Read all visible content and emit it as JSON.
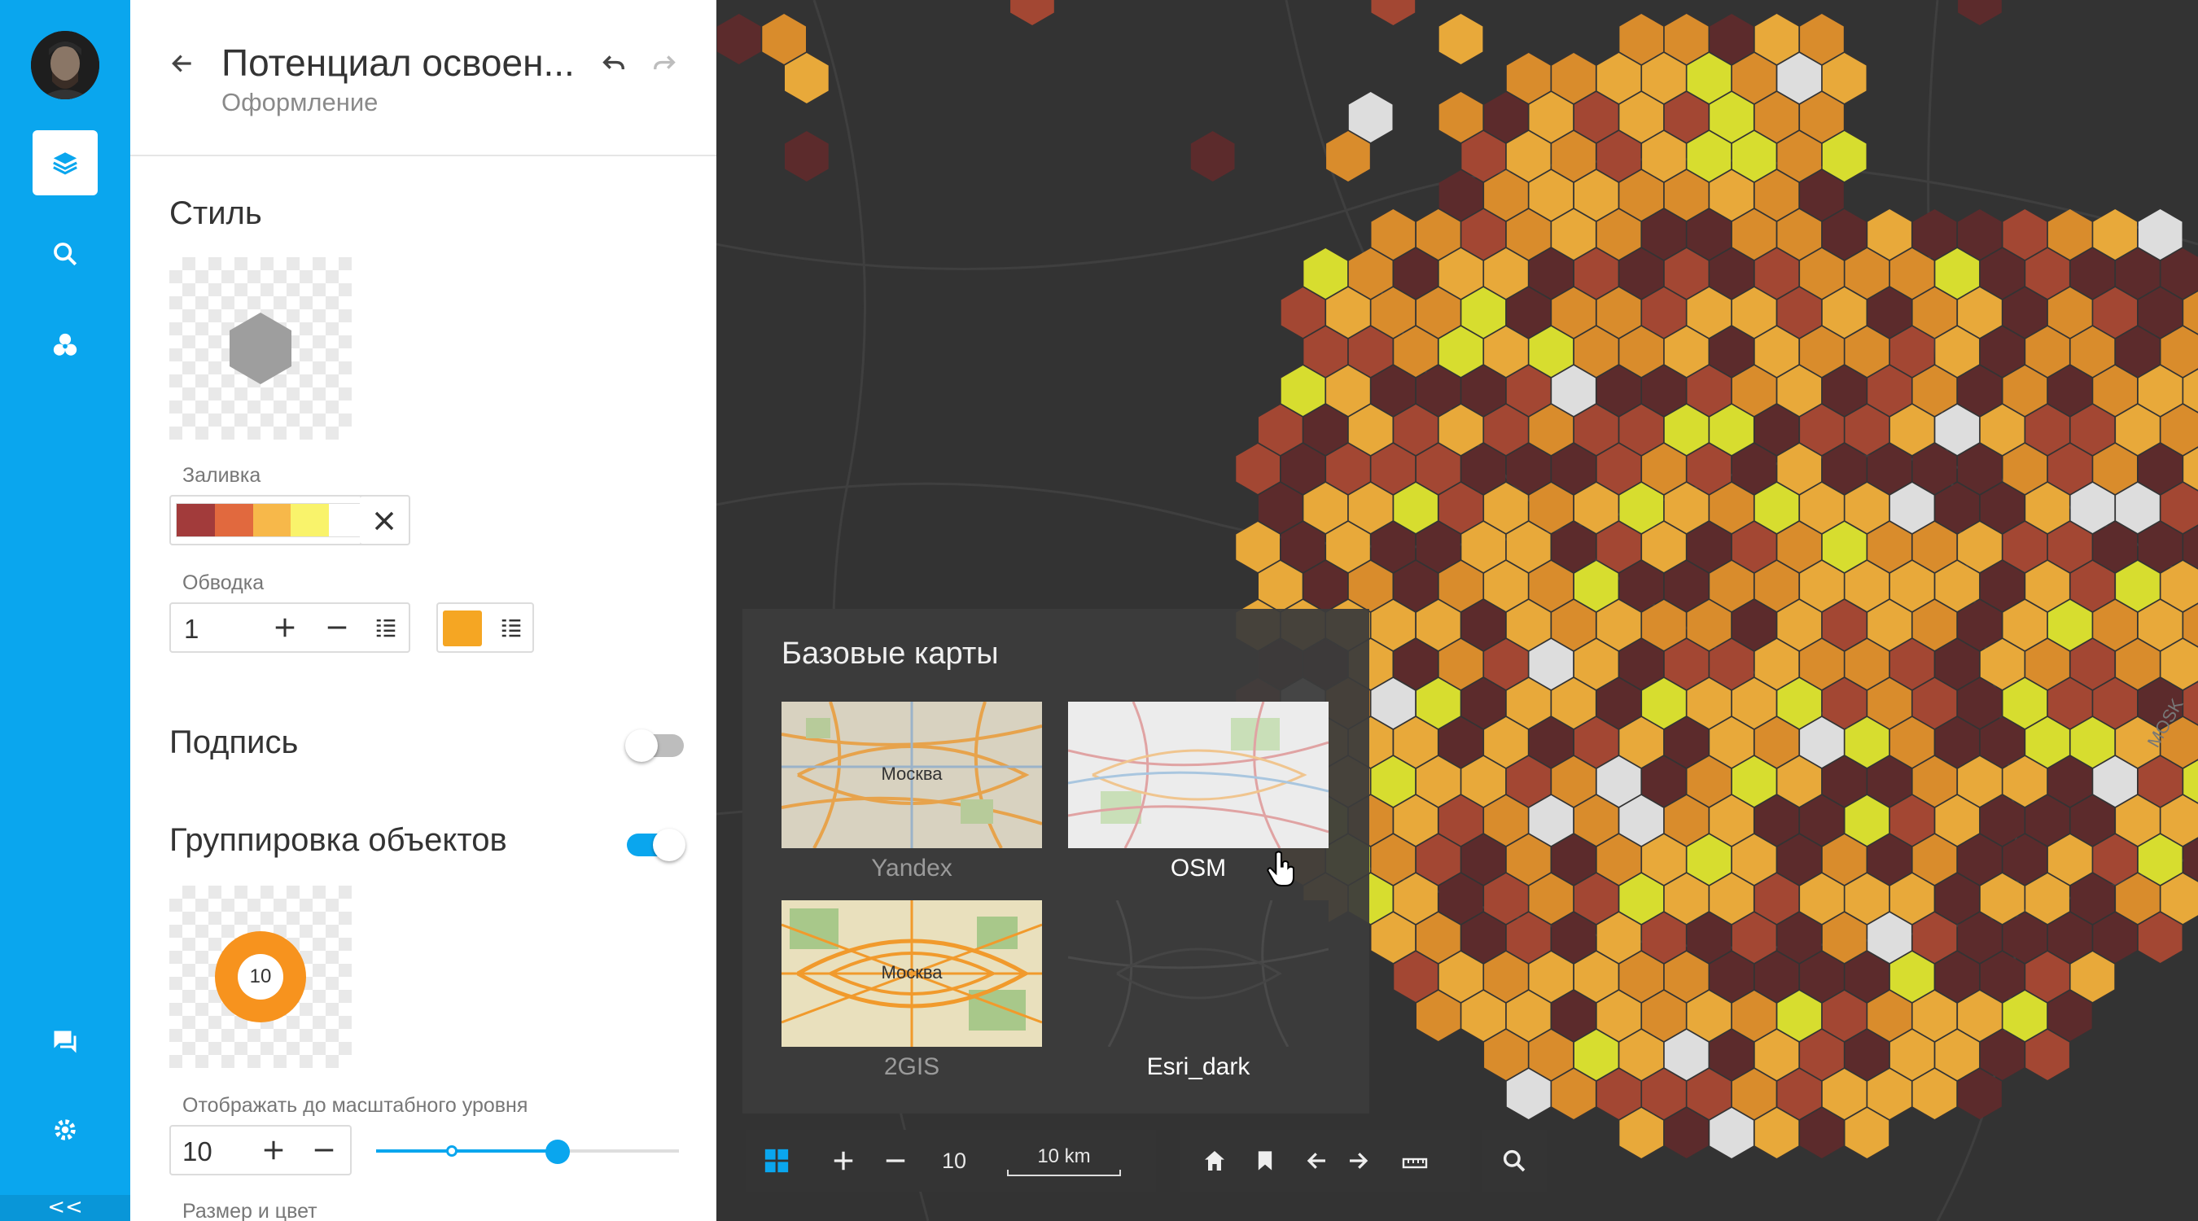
{
  "app": {
    "title": "Потенциал освоен...",
    "subtitle": "Оформление"
  },
  "rail": {
    "items": [
      "layers-icon",
      "search-icon",
      "analysis-icon"
    ],
    "bottom_items": [
      "chat-icon",
      "settings-icon"
    ],
    "collapse_label": "<<"
  },
  "style_section": {
    "title": "Стиль",
    "fill_label": "Заливка",
    "fill_colors": [
      "#a23b3b",
      "#e1693e",
      "#f7b84a",
      "#f9f36b",
      "#ffffff"
    ],
    "stroke_label": "Обводка",
    "stroke_width": "1",
    "stroke_color": "#f5a623"
  },
  "label_section": {
    "title": "Подпись",
    "enabled": false
  },
  "grouping_section": {
    "title": "Группировка объектов",
    "enabled": true,
    "cluster_count": "10",
    "zoom_level_label": "Отображать до масштабного уровня",
    "zoom_level_value": "10",
    "slider_level": 0.6,
    "size_color_label": "Размер и цвет"
  },
  "basemaps": {
    "title": "Базовые карты",
    "items": [
      {
        "name": "Yandex",
        "city": "Москва"
      },
      {
        "name": "OSM",
        "city": ""
      },
      {
        "name": "2GIS",
        "city": "Москва"
      },
      {
        "name": "Esri_dark",
        "city": ""
      }
    ],
    "selected": "Esri_dark"
  },
  "toolbar": {
    "zoom_value": "10",
    "scale_label": "10 km"
  },
  "map_labels": [
    "MOSK"
  ],
  "colors": {
    "accent": "#0aa6ee",
    "hex_palette": [
      "#5c2b2c",
      "#a34733",
      "#d98c2c",
      "#e8a93a",
      "#d7dd2f",
      "#dddddd"
    ]
  }
}
